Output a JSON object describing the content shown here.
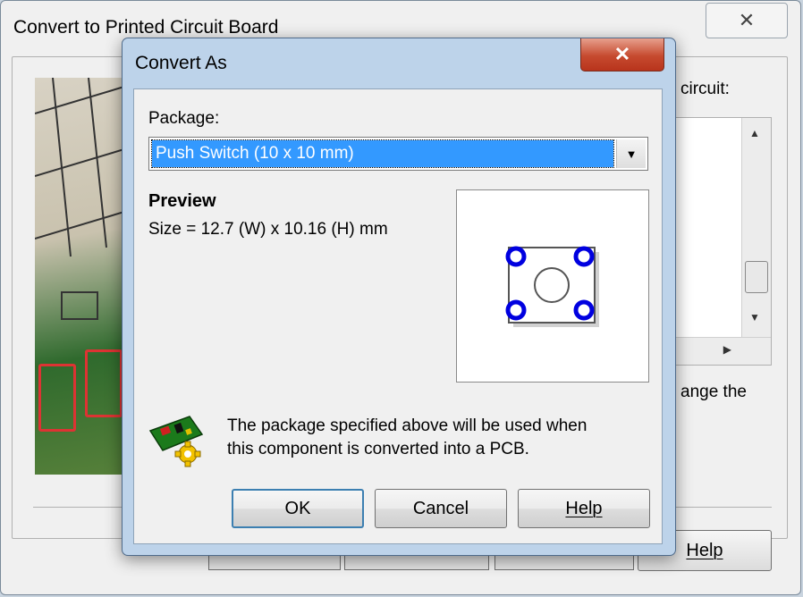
{
  "background_window": {
    "title": "Convert to Printed Circuit Board",
    "close_glyph": "✕",
    "circuit_label": "circuit:",
    "change_text": "ange the",
    "help_label": "Help"
  },
  "dialog": {
    "title": "Convert As",
    "close_glyph": "✕",
    "package_label": "Package:",
    "package_value": "Push Switch (10 x 10 mm)",
    "dropdown_glyph": "▼",
    "preview_title": "Preview",
    "preview_size": "Size = 12.7 (W) x 10.16 (H) mm",
    "info_line1": "The package specified above will be used when",
    "info_line2": "this component is converted into a PCB.",
    "buttons": {
      "ok": "OK",
      "cancel": "Cancel",
      "help": "Help"
    }
  },
  "icons": {
    "info": "pcb-gear-icon"
  },
  "colors": {
    "selection": "#3399ff",
    "close_red": "#c64a2f",
    "pad_blue": "#0000e0"
  }
}
